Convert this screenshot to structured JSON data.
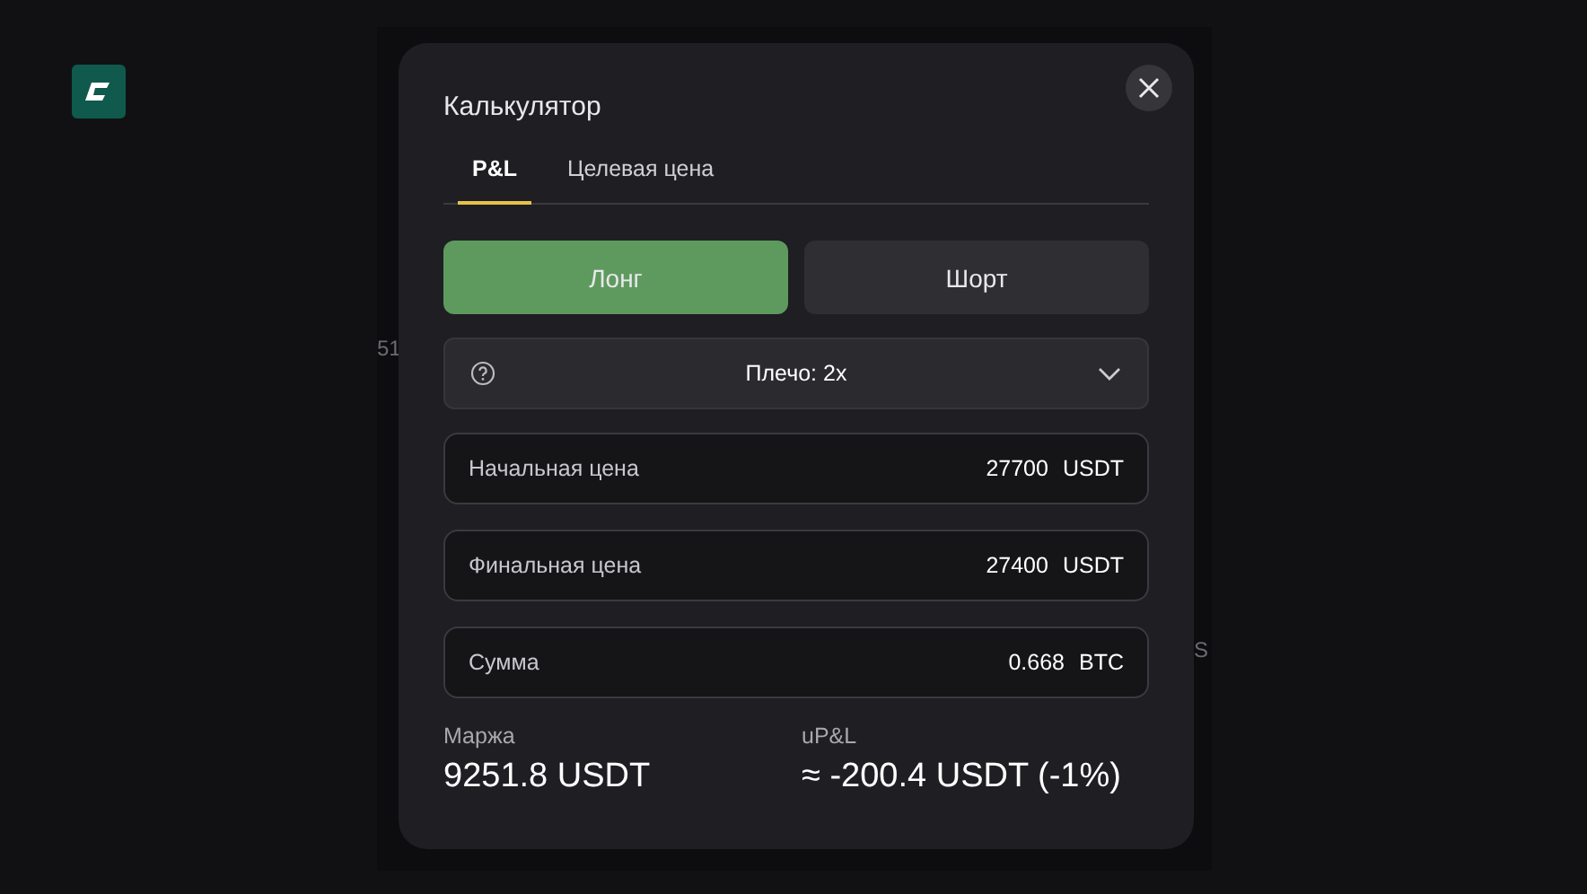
{
  "background": {
    "labels": [
      "51",
      "S"
    ]
  },
  "dialog": {
    "title": "Калькулятор",
    "tabs": [
      {
        "label": "P&L",
        "selected": true
      },
      {
        "label": "Целевая цена",
        "selected": false
      }
    ],
    "sides": [
      {
        "label": "Лонг",
        "selected": true
      },
      {
        "label": "Шорт",
        "selected": false
      }
    ],
    "leverage": {
      "label": "Плечо: 2x"
    },
    "fields": [
      {
        "label": "Начальная цена",
        "value": "27700",
        "unit": "USDT"
      },
      {
        "label": "Финальная цена",
        "value": "27400",
        "unit": "USDT"
      },
      {
        "label": "Сумма",
        "value": "0.668",
        "unit": "BTC"
      }
    ],
    "summary": [
      {
        "label": "Маржа",
        "value": "9251.8 USDT"
      },
      {
        "label": "uP&L",
        "value": "≈ -200.4 USDT (-1%)"
      }
    ]
  }
}
